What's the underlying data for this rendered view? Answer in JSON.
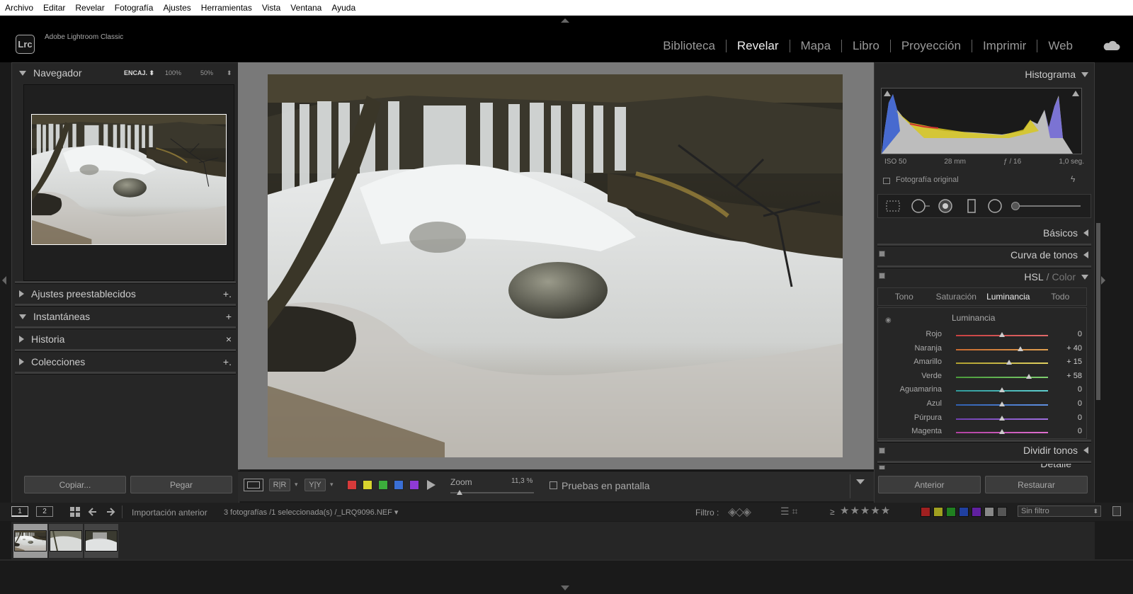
{
  "menu": [
    "Archivo",
    "Editar",
    "Revelar",
    "Fotografía",
    "Ajustes",
    "Herramientas",
    "Vista",
    "Ventana",
    "Ayuda"
  ],
  "app": {
    "logo": "Lrc",
    "title": "Adobe Lightroom Classic"
  },
  "modules": [
    {
      "label": "Biblioteca",
      "active": false
    },
    {
      "label": "Revelar",
      "active": true
    },
    {
      "label": "Mapa",
      "active": false
    },
    {
      "label": "Libro",
      "active": false
    },
    {
      "label": "Proyección",
      "active": false
    },
    {
      "label": "Imprimir",
      "active": false
    },
    {
      "label": "Web",
      "active": false
    }
  ],
  "left": {
    "navigator": {
      "title": "Navegador",
      "zoom_fit": "ENCAJ. ⬍",
      "zoom_100": "100%",
      "zoom_50": "50%",
      "zoom_more": "⬍"
    },
    "panels": [
      {
        "title": "Ajustes preestablecidos",
        "action": "+.",
        "expanded": false
      },
      {
        "title": "Instantáneas",
        "action": "+",
        "expanded": true
      },
      {
        "title": "Historia",
        "action": "×",
        "expanded": false
      },
      {
        "title": "Colecciones",
        "action": "+.",
        "expanded": false
      }
    ],
    "copy_label": "Copiar...",
    "paste_label": "Pegar"
  },
  "toolbar": {
    "view_rr": "R|R",
    "view_yy": "Y|Y",
    "color_labels": [
      "#d63a3a",
      "#d8d42e",
      "#3cae3c",
      "#3a6fd6",
      "#8e3ad6"
    ],
    "zoom_label": "Zoom",
    "zoom_value": "11,3 %",
    "zoom_level": 0.113,
    "softproof_label": "Pruebas en pantalla"
  },
  "right": {
    "histogram": {
      "title": "Histograma",
      "iso": "ISO 50",
      "focal": "28 mm",
      "aperture": "ƒ / 16",
      "shutter": "1,0 seg.",
      "original_label": "Fotografía original"
    },
    "basic": "Básicos",
    "tone_curve": "Curva de tonos",
    "hsl": {
      "title": "HSL",
      "color_title": "Color",
      "separator": "/",
      "tabs": [
        {
          "label": "Tono",
          "active": false
        },
        {
          "label": "Saturación",
          "active": false
        },
        {
          "label": "Luminancia",
          "active": true
        },
        {
          "label": "Todo",
          "active": false
        }
      ],
      "section_title": "Luminancia",
      "sliders": [
        {
          "label": "Rojo",
          "value": "0",
          "pos": 0,
          "from": "#c84040",
          "to": "#e06a6a"
        },
        {
          "label": "Naranja",
          "value": "+ 40",
          "pos": 40,
          "from": "#c86a30",
          "to": "#e0a050"
        },
        {
          "label": "Amarillo",
          "value": "+ 15",
          "pos": 15,
          "from": "#b0a030",
          "to": "#e0d060"
        },
        {
          "label": "Verde",
          "value": "+ 58",
          "pos": 58,
          "from": "#4a9a3a",
          "to": "#80d070"
        },
        {
          "label": "Aguamarina",
          "value": "0",
          "pos": 0,
          "from": "#309a9a",
          "to": "#60d0d0"
        },
        {
          "label": "Azul",
          "value": "0",
          "pos": 0,
          "from": "#3060b0",
          "to": "#6090e0"
        },
        {
          "label": "Púrpura",
          "value": "0",
          "pos": 0,
          "from": "#7040b0",
          "to": "#a070e0"
        },
        {
          "label": "Magenta",
          "value": "0",
          "pos": 0,
          "from": "#b040a0",
          "to": "#e070d0"
        }
      ]
    },
    "split_tone": "Dividir tonos",
    "detail": "Detalle",
    "prev_label": "Anterior",
    "reset_label": "Restaurar"
  },
  "filmbar": {
    "page1": "1",
    "page2": "2",
    "source": "Importación anterior",
    "info": "3 fotografías /1 seleccionada(s) /_LRQ9096.NEF ▾",
    "filter_label": "Filtro :",
    "rating_op": "≥",
    "filter_value": "Sin filtro",
    "label_colors": [
      "#a02020",
      "#a0a020",
      "#208020",
      "#2040a0",
      "#6020a0",
      "#888888",
      "#555555"
    ]
  }
}
